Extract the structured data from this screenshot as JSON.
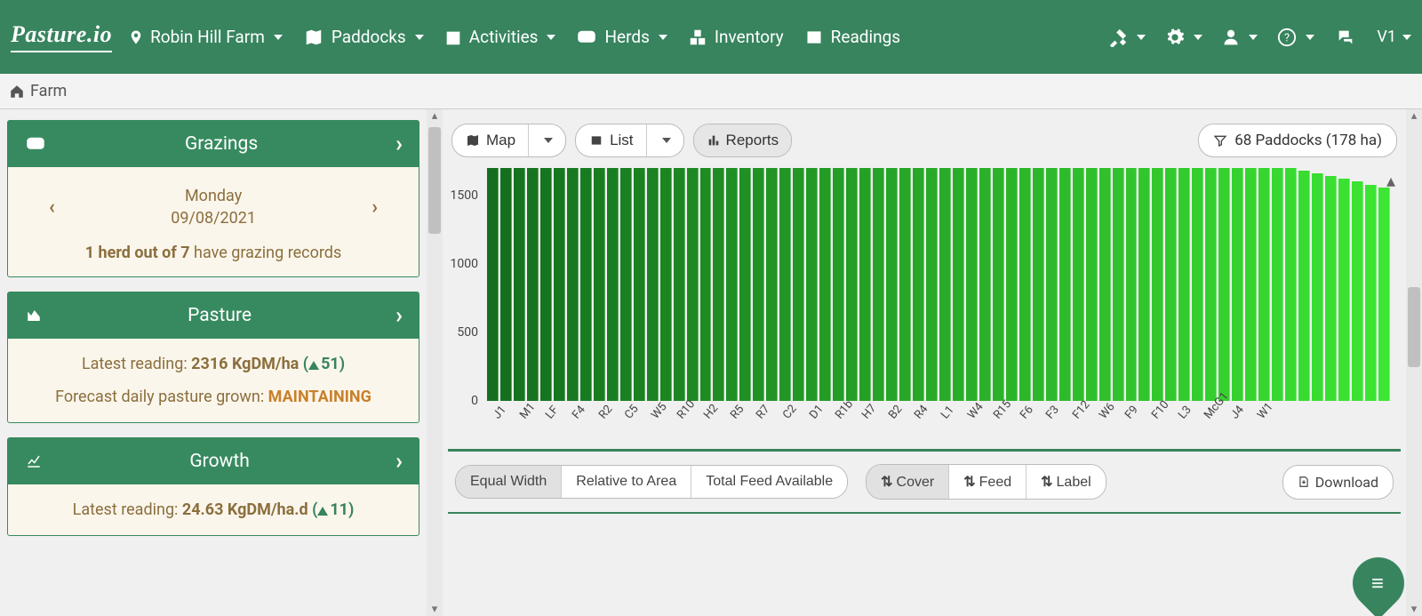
{
  "brand": "Pasture.io",
  "nav": {
    "farm": "Robin Hill Farm",
    "paddocks": "Paddocks",
    "activities": "Activities",
    "herds": "Herds",
    "inventory": "Inventory",
    "readings": "Readings",
    "version": "V1"
  },
  "breadcrumb": {
    "farm": "Farm"
  },
  "cards": {
    "grazings": {
      "title": "Grazings",
      "day": "Monday",
      "date": "09/08/2021",
      "herd_bold": "1 herd out of 7",
      "herd_rest": " have grazing records"
    },
    "pasture": {
      "title": "Pasture",
      "latest_label": "Latest reading: ",
      "latest_value": "2316 KgDM/ha",
      "latest_trend": "51",
      "forecast_label": "Forecast daily pasture grown: ",
      "forecast_value": "MAINTAINING"
    },
    "growth": {
      "title": "Growth",
      "latest_label": "Latest reading: ",
      "latest_value": "24.63 KgDM/ha.d",
      "latest_trend": "11"
    }
  },
  "toolbar": {
    "map": "Map",
    "list": "List",
    "reports": "Reports",
    "filter": "68 Paddocks (178 ha)"
  },
  "controls": {
    "equal": "Equal Width",
    "relative": "Relative to Area",
    "total": "Total Feed Available",
    "cover": "Cover",
    "feed": "Feed",
    "label": "Label",
    "download": "Download"
  },
  "chart_data": {
    "type": "bar",
    "ylabel": "",
    "ylim": [
      0,
      1700
    ],
    "y_ticks": [
      0,
      500,
      1000,
      1500
    ],
    "categories": [
      "J1",
      "M1",
      "LF",
      "F4",
      "R2",
      "C5",
      "W5",
      "R10",
      "H2",
      "R5",
      "R7",
      "C2",
      "D1",
      "R1b",
      "H7",
      "B2",
      "R4",
      "L1",
      "W4",
      "R15",
      "F6",
      "F3",
      "F12",
      "W6",
      "F9",
      "F10",
      "L3",
      "McG1",
      "J4",
      "W1"
    ],
    "values": [
      1700,
      1700,
      1700,
      1700,
      1700,
      1700,
      1700,
      1700,
      1700,
      1700,
      1700,
      1700,
      1700,
      1700,
      1700,
      1700,
      1700,
      1700,
      1700,
      1700,
      1700,
      1700,
      1700,
      1700,
      1700,
      1700,
      1700,
      1700,
      1700,
      1700,
      1700,
      1700,
      1700,
      1700,
      1700,
      1700,
      1700,
      1700,
      1700,
      1700,
      1700,
      1700,
      1700,
      1700,
      1700,
      1700,
      1700,
      1700,
      1700,
      1700,
      1700,
      1700,
      1700,
      1700,
      1700,
      1700,
      1700,
      1700,
      1700,
      1700,
      1700,
      1680,
      1660,
      1640,
      1620,
      1600,
      1580,
      1560
    ]
  }
}
